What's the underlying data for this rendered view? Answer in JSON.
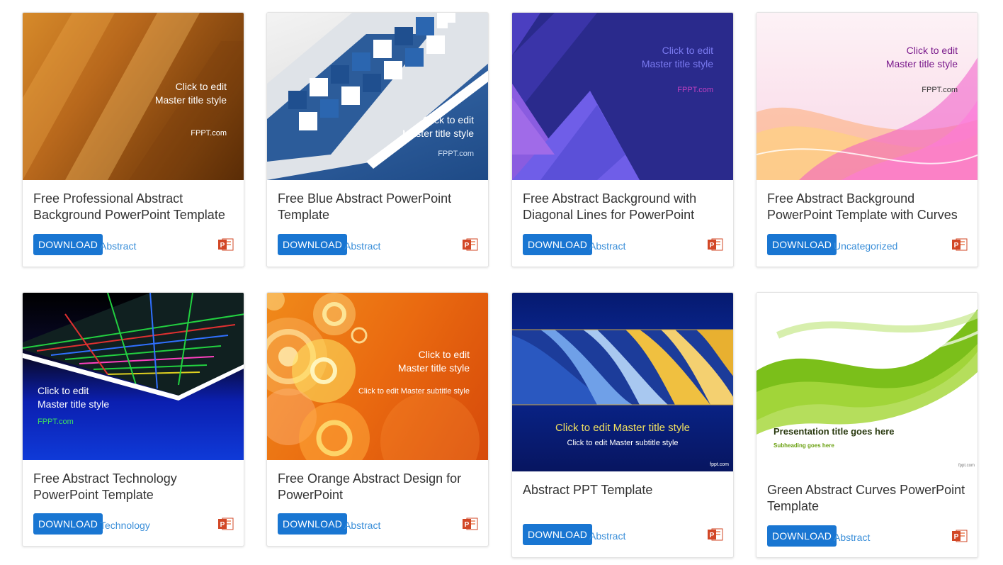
{
  "download_label": "DOWNLOAD",
  "cards": [
    {
      "title": "Free Professional Abstract Background PowerPoint Template",
      "category": "Abstract",
      "thumb_title_1": "Click to edit",
      "thumb_title_2": "Master title style",
      "thumb_brand": "FPPT.com"
    },
    {
      "title": "Free Blue Abstract PowerPoint Template",
      "category": "Abstract",
      "thumb_title_1": "Click to edit",
      "thumb_title_2": "Master title style",
      "thumb_brand": "FPPT.com"
    },
    {
      "title": "Free Abstract Background with Diagonal Lines for PowerPoint",
      "category": "Abstract",
      "thumb_title_1": "Click to edit",
      "thumb_title_2": "Master title style",
      "thumb_brand": "FPPT.com"
    },
    {
      "title": "Free Abstract Background PowerPoint Template with Curves",
      "category": "Uncategorized",
      "thumb_title_1": "Click to edit",
      "thumb_title_2": "Master title style",
      "thumb_brand": "FPPT.com"
    },
    {
      "title": "Free Abstract Technology PowerPoint Template",
      "category": "Technology",
      "thumb_title_1": "Click to edit",
      "thumb_title_2": "Master title style",
      "thumb_brand": "FPPT.com"
    },
    {
      "title": "Free Orange Abstract Design for PowerPoint",
      "category": "Abstract",
      "thumb_title_1": "Click to edit",
      "thumb_title_2": "Master title style",
      "thumb_subtitle": "Click to edit Master subtitle style"
    },
    {
      "title": "Abstract PPT Template",
      "category": "Abstract",
      "thumb_title": "Click to edit Master title style",
      "thumb_subtitle": "Click to edit Master subtitle style",
      "thumb_brand": "fppt.com"
    },
    {
      "title": "Green Abstract Curves PowerPoint Template",
      "category": "Abstract",
      "thumb_title": "Presentation title goes here",
      "thumb_subtitle": "Subheading goes here",
      "thumb_brand": "fppt.com"
    }
  ],
  "colors": {
    "button_bg": "#1976d2",
    "link": "#3b8fd9",
    "ppt_icon": "#d24726"
  }
}
